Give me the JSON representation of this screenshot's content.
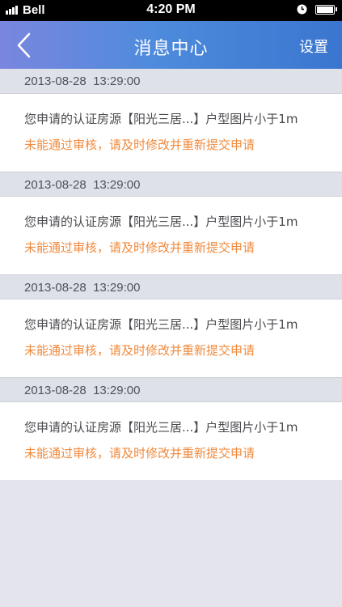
{
  "status_bar": {
    "carrier": "Bell",
    "time": "4:20 PM",
    "icons": [
      "signal-icon",
      "clock-icon",
      "battery-icon"
    ]
  },
  "nav": {
    "back_icon": "chevron-left-icon",
    "title": "消息中心",
    "settings_label": "设置"
  },
  "colors": {
    "nav_gradient_start": "#7a86df",
    "nav_gradient_end": "#3a76cf",
    "warning_text": "#f08a3c",
    "background": "#e4e5ec"
  },
  "messages": [
    {
      "time": "2013-08-28  13:29:00",
      "line1": "您申请的认证房源【阳光三居...】户型图片小于1m",
      "line2": "未能通过审核，请及时修改并重新提交申请"
    },
    {
      "time": "2013-08-28  13:29:00",
      "line1": "您申请的认证房源【阳光三居...】户型图片小于1m",
      "line2": "未能通过审核，请及时修改并重新提交申请"
    },
    {
      "time": "2013-08-28  13:29:00",
      "line1": "您申请的认证房源【阳光三居...】户型图片小于1m",
      "line2": "未能通过审核，请及时修改并重新提交申请"
    },
    {
      "time": "2013-08-28  13:29:00",
      "line1": "您申请的认证房源【阳光三居...】户型图片小于1m",
      "line2": "未能通过审核，请及时修改并重新提交申请"
    }
  ]
}
